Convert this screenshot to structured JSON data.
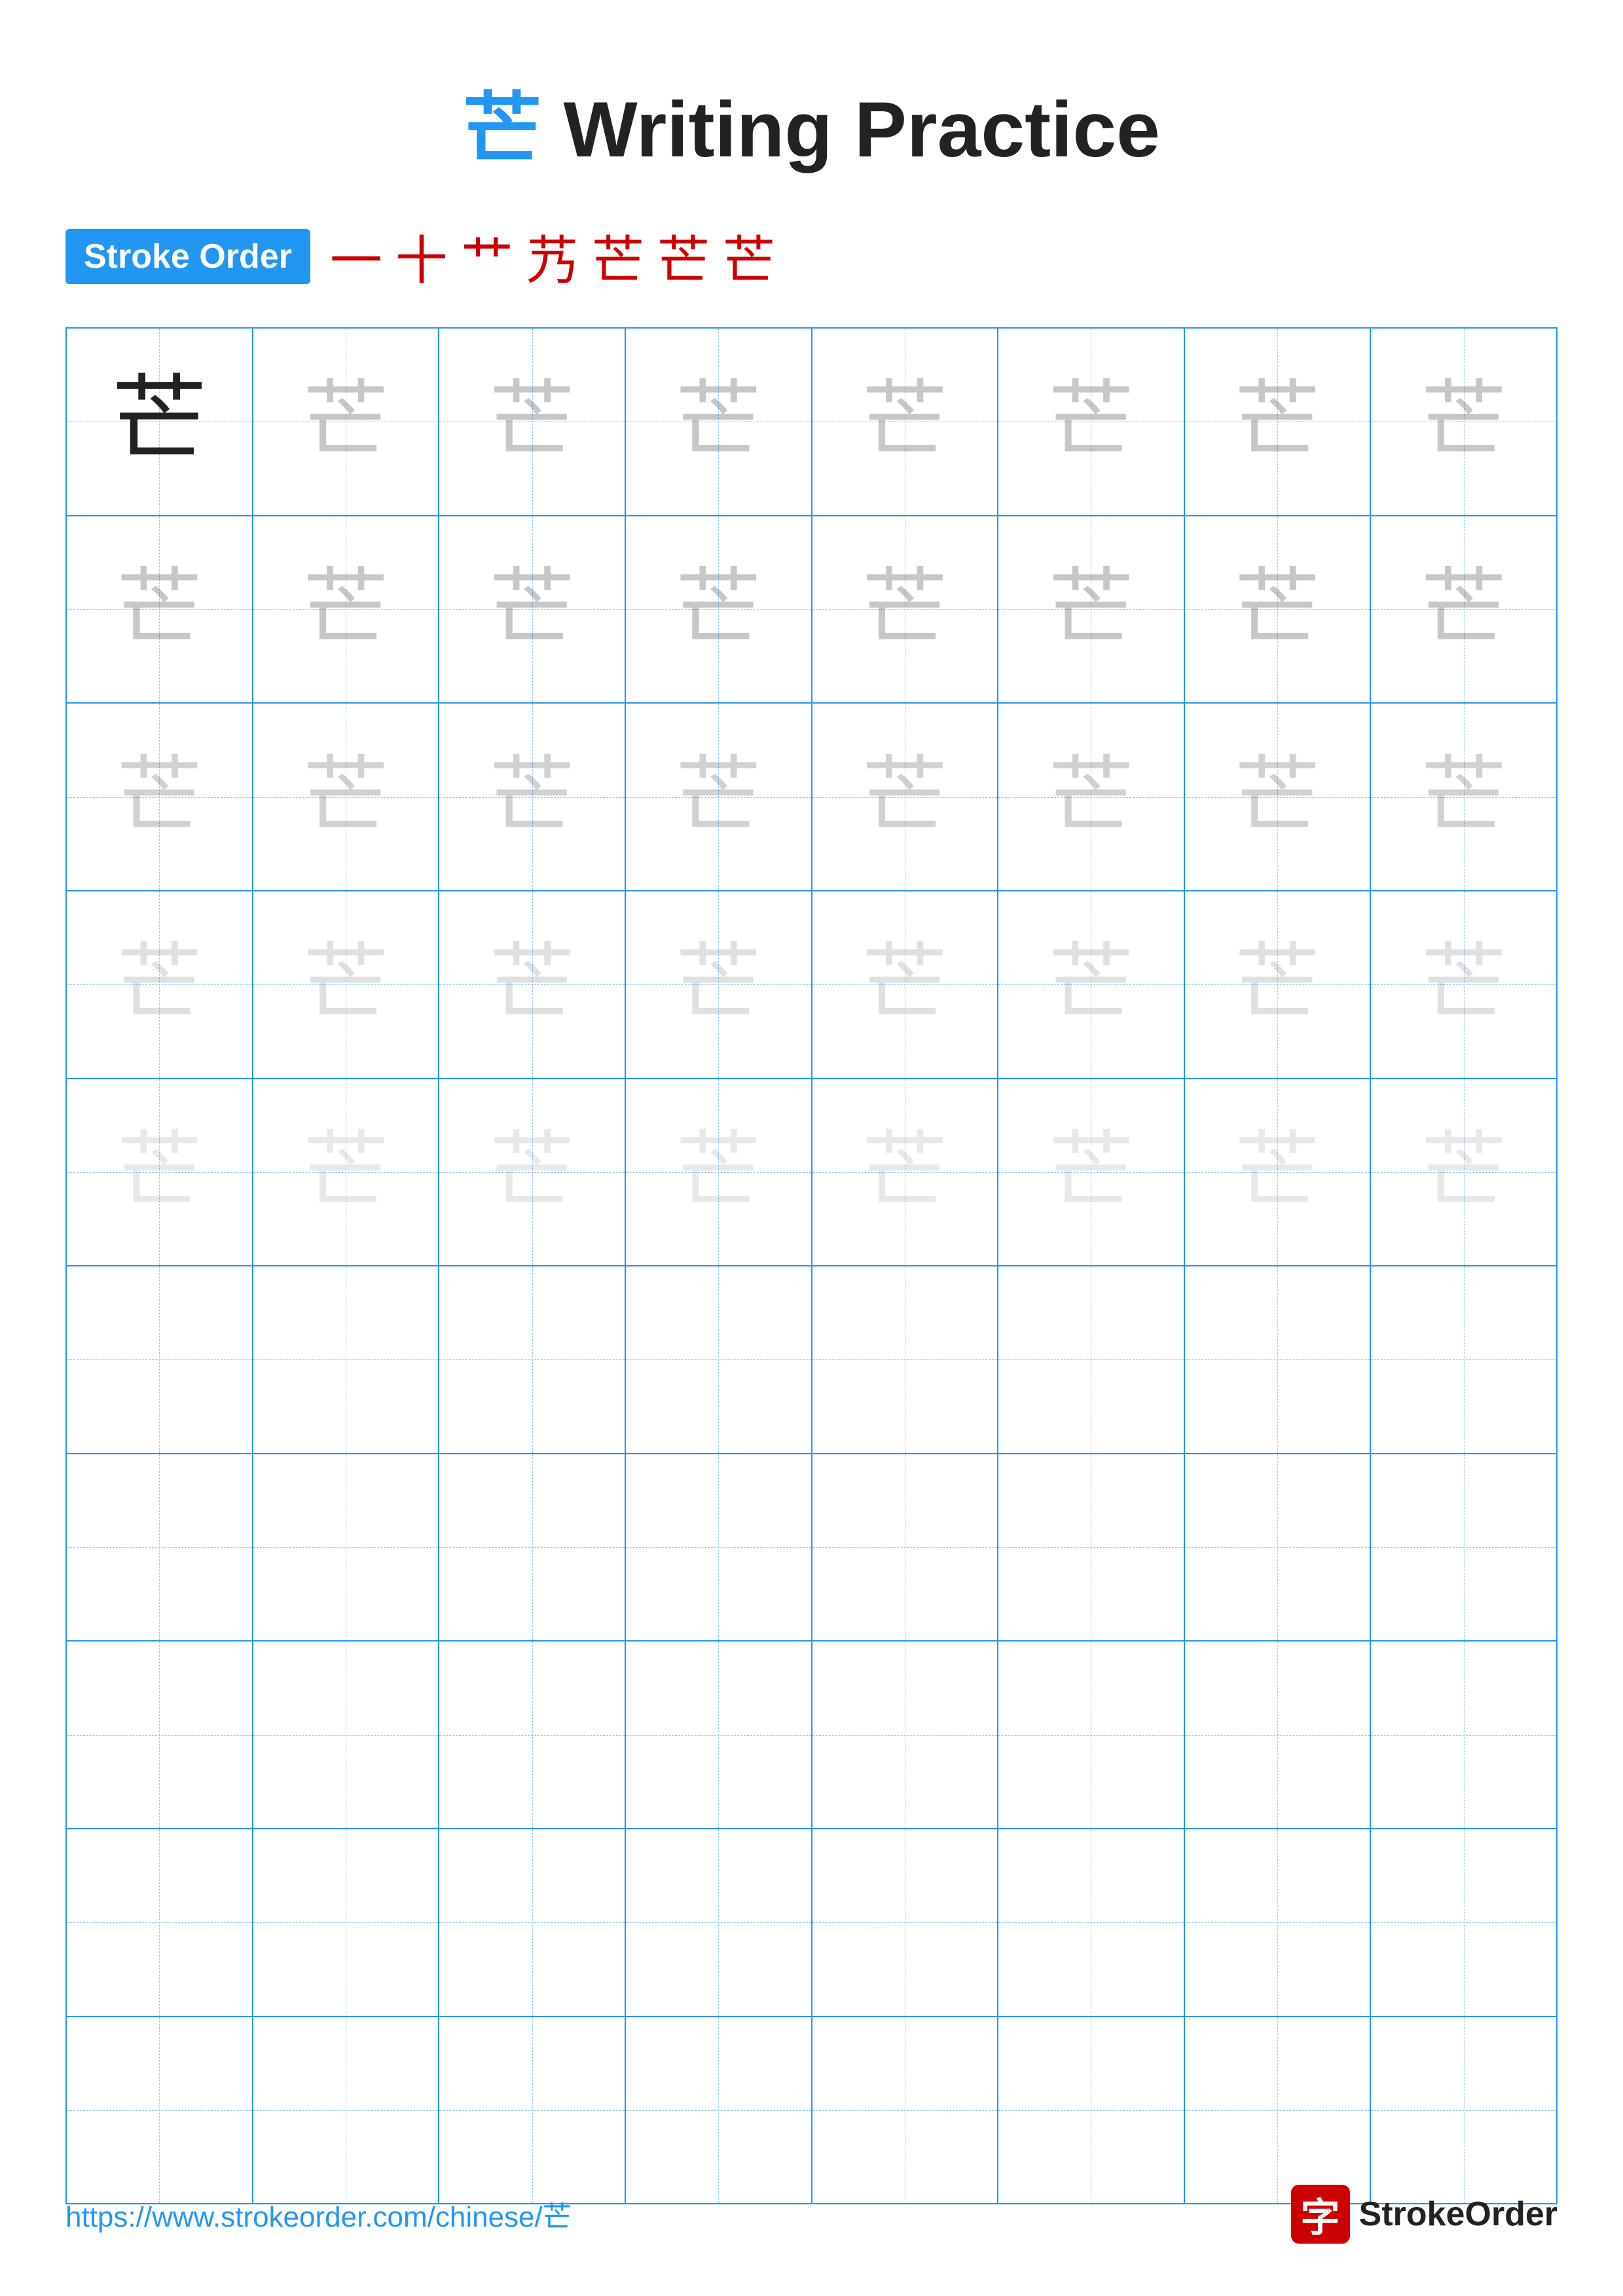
{
  "header": {
    "char": "芒",
    "title": "Writing Practice"
  },
  "stroke_order": {
    "badge_label": "Stroke Order",
    "strokes": [
      "一",
      "十",
      "艹",
      "艿",
      "芒",
      "芒",
      "芒"
    ]
  },
  "grid": {
    "cols": 8,
    "rows": 10,
    "practice_char": "芒",
    "filled_rows": 5,
    "empty_rows": 5
  },
  "footer": {
    "url": "https://www.strokeorder.com/chinese/芒",
    "logo_char": "字",
    "logo_text": "StrokeOrder"
  }
}
